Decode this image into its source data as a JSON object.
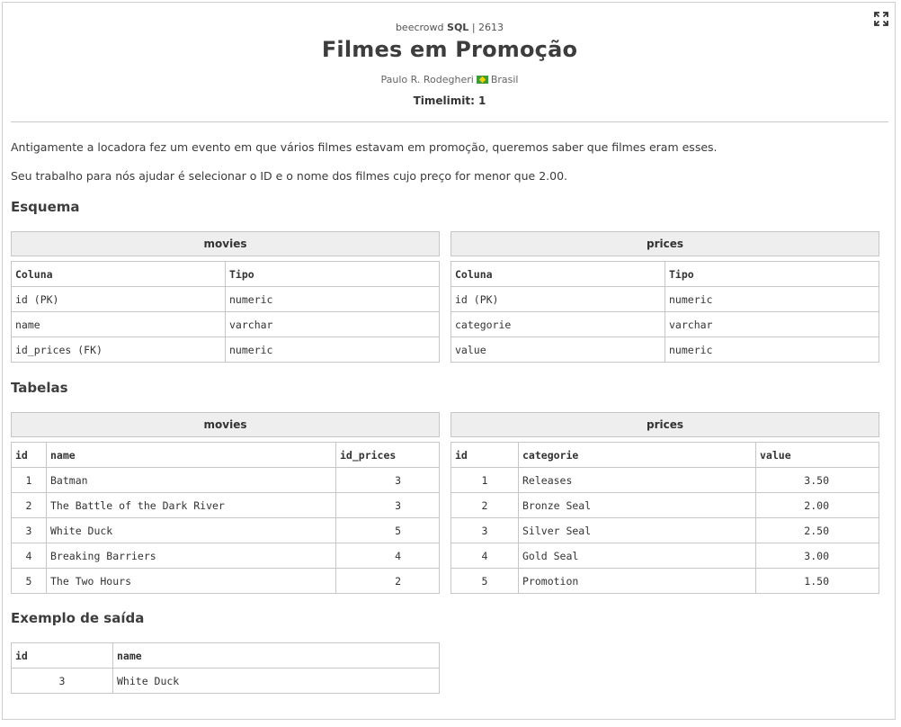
{
  "header": {
    "source_prefix": "beecrowd",
    "source_category": "SQL",
    "source_sep": "|",
    "problem_number": "2613",
    "title": "Filmes em Promoção",
    "author": "Paulo R. Rodegheri",
    "country": "Brasil",
    "timelimit": "Timelimit: 1"
  },
  "description": {
    "p1": "Antigamente a locadora fez um evento em que vários filmes estavam em promoção, queremos saber que filmes eram esses.",
    "p2": "Seu trabalho para nós ajudar é selecionar o ID e o nome dos filmes cujo preço for menor que 2.00."
  },
  "schema": {
    "heading": "Esquema",
    "movies": {
      "caption": "movies",
      "headers": [
        "Coluna",
        "Tipo"
      ],
      "rows": [
        [
          "id (PK)",
          "numeric"
        ],
        [
          "name",
          "varchar"
        ],
        [
          "id_prices (FK)",
          "numeric"
        ]
      ]
    },
    "prices": {
      "caption": "prices",
      "headers": [
        "Coluna",
        "Tipo"
      ],
      "rows": [
        [
          "id (PK)",
          "numeric"
        ],
        [
          "categorie",
          "varchar"
        ],
        [
          "value",
          "numeric"
        ]
      ]
    }
  },
  "tables": {
    "heading": "Tabelas",
    "movies": {
      "caption": "movies",
      "headers": [
        "id",
        "name",
        "id_prices"
      ],
      "rows": [
        [
          "1",
          "Batman",
          "3"
        ],
        [
          "2",
          "The Battle of the Dark River",
          "3"
        ],
        [
          "3",
          "White Duck",
          "5"
        ],
        [
          "4",
          "Breaking Barriers",
          "4"
        ],
        [
          "5",
          "The Two Hours",
          "2"
        ]
      ]
    },
    "prices": {
      "caption": "prices",
      "headers": [
        "id",
        "categorie",
        "value"
      ],
      "rows": [
        [
          "1",
          "Releases",
          "3.50"
        ],
        [
          "2",
          "Bronze Seal",
          "2.00"
        ],
        [
          "3",
          "Silver Seal",
          "2.50"
        ],
        [
          "4",
          "Gold Seal",
          "3.00"
        ],
        [
          "5",
          "Promotion",
          "1.50"
        ]
      ]
    }
  },
  "output": {
    "heading": "Exemplo de saída",
    "headers": [
      "id",
      "name"
    ],
    "rows": [
      [
        "3",
        "White Duck"
      ]
    ]
  },
  "icons": {
    "expand": "expand-icon",
    "flag": "brazil-flag-icon"
  }
}
